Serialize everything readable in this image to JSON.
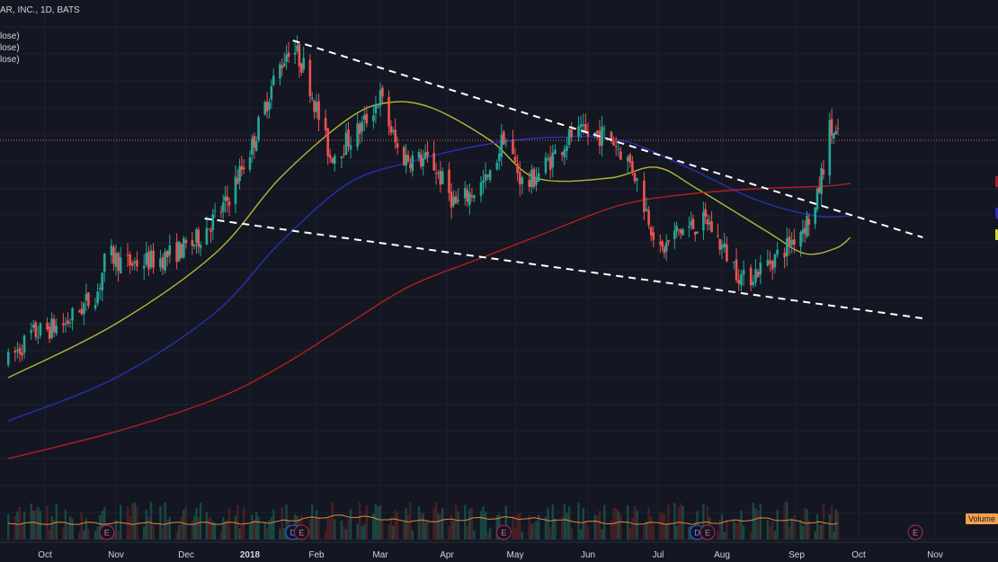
{
  "header": {
    "symbol_title": "AR, INC., 1D, BATS"
  },
  "legend": {
    "lines": [
      "lose)",
      "lose)",
      "lose)"
    ]
  },
  "volume_label": "Volume",
  "colors": {
    "background": "#131722",
    "grid": "#1e2230",
    "up_candle": "#26a69a",
    "down_candle": "#ef5350",
    "ma_fast": "#b5b830",
    "ma_mid": "#2a2fb0",
    "ma_slow": "#b01e22",
    "trendline": "#ffffff",
    "price_line": "#ef5350",
    "volume_line": "#e08a3a"
  },
  "events": [
    {
      "label": "E",
      "kind": "earnings",
      "date": "2017-10-28"
    },
    {
      "label": "D",
      "kind": "dividend",
      "date": "2018-01-21"
    },
    {
      "label": "E",
      "kind": "earnings",
      "date": "2018-01-25"
    },
    {
      "label": "E",
      "kind": "earnings",
      "date": "2018-04-26"
    },
    {
      "label": "D",
      "kind": "dividend",
      "date": "2018-07-20"
    },
    {
      "label": "E",
      "kind": "earnings",
      "date": "2018-07-25"
    },
    {
      "label": "E",
      "kind": "earnings",
      "date": "2018-10-24"
    }
  ],
  "chart_data": {
    "type": "candlestick",
    "title": "AR, INC., 1D, BATS",
    "x_axis": {
      "ticks": [
        {
          "label": "Oct",
          "date": "2017-10-01"
        },
        {
          "label": "Nov",
          "date": "2017-11-01"
        },
        {
          "label": "Dec",
          "date": "2017-12-01"
        },
        {
          "label": "2018",
          "date": "2018-01-01",
          "bold": true
        },
        {
          "label": "Feb",
          "date": "2018-02-01"
        },
        {
          "label": "Mar",
          "date": "2018-03-01"
        },
        {
          "label": "Apr",
          "date": "2018-04-01"
        },
        {
          "label": "May",
          "date": "2018-05-01"
        },
        {
          "label": "Jun",
          "date": "2018-06-01"
        },
        {
          "label": "Jul",
          "date": "2018-07-01"
        },
        {
          "label": "Aug",
          "date": "2018-08-01"
        },
        {
          "label": "Sep",
          "date": "2018-09-01"
        },
        {
          "label": "Oct",
          "date": "2018-10-01"
        },
        {
          "label": "Nov",
          "date": "2018-11-01"
        }
      ]
    },
    "price_range": [
      0,
      100
    ],
    "current_price": 79,
    "trendlines": [
      {
        "name": "upper",
        "from": {
          "date": "2018-01-21",
          "price": 97.5
        },
        "to": {
          "date": "2018-10-27",
          "price": 61
        }
      },
      {
        "name": "lower",
        "from": {
          "date": "2017-12-10",
          "price": 64.5
        },
        "to": {
          "date": "2018-10-27",
          "price": 46
        }
      }
    ],
    "anchors": [
      {
        "date": "2017-09-15",
        "price": 38
      },
      {
        "date": "2017-09-25",
        "price": 43
      },
      {
        "date": "2017-10-10",
        "price": 45
      },
      {
        "date": "2017-10-24",
        "price": 51
      },
      {
        "date": "2017-10-28",
        "price": 58
      },
      {
        "date": "2017-11-05",
        "price": 56
      },
      {
        "date": "2017-11-20",
        "price": 57
      },
      {
        "date": "2017-12-05",
        "price": 60
      },
      {
        "date": "2017-12-20",
        "price": 67
      },
      {
        "date": "2018-01-02",
        "price": 78
      },
      {
        "date": "2018-01-12",
        "price": 90
      },
      {
        "date": "2018-01-20",
        "price": 97
      },
      {
        "date": "2018-01-27",
        "price": 92
      },
      {
        "date": "2018-02-07",
        "price": 76
      },
      {
        "date": "2018-02-20",
        "price": 81
      },
      {
        "date": "2018-03-01",
        "price": 87
      },
      {
        "date": "2018-03-10",
        "price": 76
      },
      {
        "date": "2018-03-25",
        "price": 75
      },
      {
        "date": "2018-04-05",
        "price": 67
      },
      {
        "date": "2018-04-20",
        "price": 72
      },
      {
        "date": "2018-04-26",
        "price": 80
      },
      {
        "date": "2018-05-05",
        "price": 70
      },
      {
        "date": "2018-05-15",
        "price": 75
      },
      {
        "date": "2018-05-25",
        "price": 80
      },
      {
        "date": "2018-06-10",
        "price": 80
      },
      {
        "date": "2018-06-20",
        "price": 74
      },
      {
        "date": "2018-07-02",
        "price": 58
      },
      {
        "date": "2018-07-10",
        "price": 62
      },
      {
        "date": "2018-07-25",
        "price": 64
      },
      {
        "date": "2018-08-10",
        "price": 53
      },
      {
        "date": "2018-08-25",
        "price": 58
      },
      {
        "date": "2018-09-10",
        "price": 66
      },
      {
        "date": "2018-09-17",
        "price": 81
      },
      {
        "date": "2018-09-22",
        "price": 79
      }
    ],
    "moving_averages": [
      {
        "name": "fast",
        "color": "#b5b830",
        "points": [
          [
            "2017-09-15",
            35
          ],
          [
            "2017-11-01",
            45
          ],
          [
            "2017-12-15",
            58
          ],
          [
            "2018-01-15",
            72
          ],
          [
            "2018-02-15",
            83
          ],
          [
            "2018-03-05",
            86
          ],
          [
            "2018-03-25",
            85
          ],
          [
            "2018-04-20",
            79
          ],
          [
            "2018-05-10",
            72
          ],
          [
            "2018-06-10",
            72
          ],
          [
            "2018-06-30",
            74
          ],
          [
            "2018-07-20",
            70
          ],
          [
            "2018-08-20",
            62
          ],
          [
            "2018-09-05",
            58
          ],
          [
            "2018-09-20",
            59
          ],
          [
            "2018-09-27",
            61
          ]
        ]
      },
      {
        "name": "mid",
        "color": "#2a2fb0",
        "points": [
          [
            "2017-09-15",
            27
          ],
          [
            "2017-11-01",
            35
          ],
          [
            "2017-12-15",
            47
          ],
          [
            "2018-01-15",
            60
          ],
          [
            "2018-02-15",
            71
          ],
          [
            "2018-03-15",
            75
          ],
          [
            "2018-04-15",
            78
          ],
          [
            "2018-05-15",
            79.5
          ],
          [
            "2018-06-15",
            79
          ],
          [
            "2018-07-15",
            74
          ],
          [
            "2018-08-15",
            68
          ],
          [
            "2018-09-10",
            65
          ],
          [
            "2018-09-27",
            65
          ]
        ]
      },
      {
        "name": "slow",
        "color": "#b01e22",
        "points": [
          [
            "2017-09-15",
            20
          ],
          [
            "2017-11-01",
            25
          ],
          [
            "2017-12-15",
            31
          ],
          [
            "2018-01-15",
            37
          ],
          [
            "2018-02-15",
            45
          ],
          [
            "2018-03-15",
            52
          ],
          [
            "2018-04-15",
            57
          ],
          [
            "2018-05-15",
            62
          ],
          [
            "2018-06-15",
            67
          ],
          [
            "2018-07-15",
            69
          ],
          [
            "2018-08-15",
            70
          ],
          [
            "2018-09-15",
            70.5
          ],
          [
            "2018-09-27",
            71
          ]
        ]
      }
    ]
  }
}
